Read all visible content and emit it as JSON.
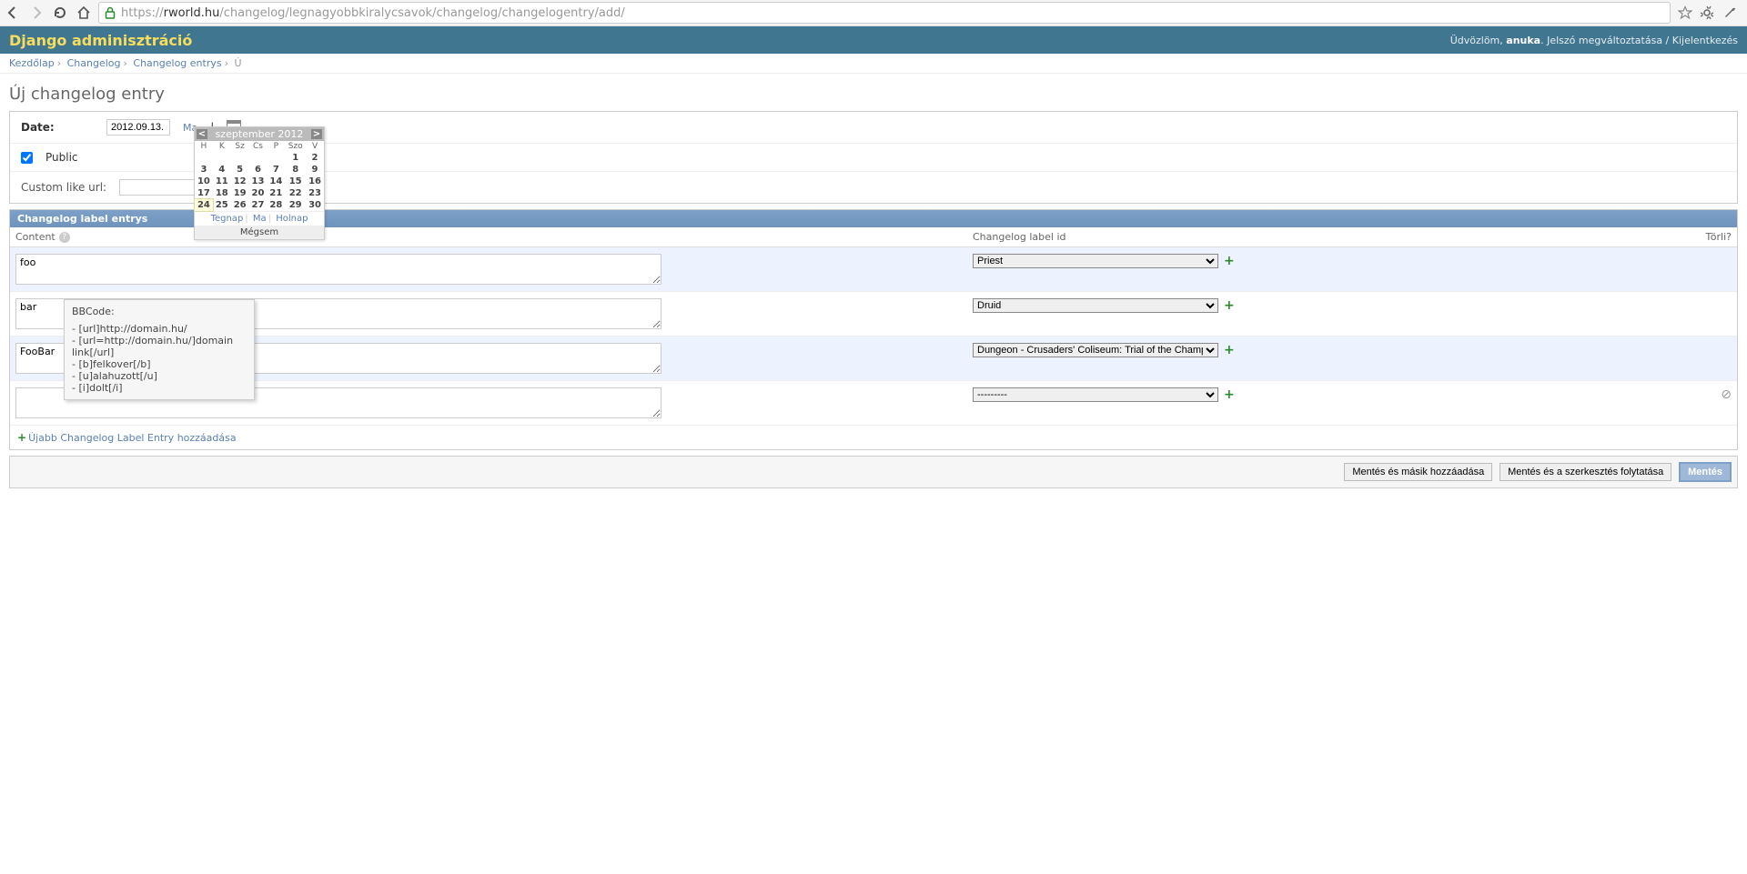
{
  "browser": {
    "url_prefix": "https://",
    "url_host": "rworld.hu",
    "url_path": "/changelog/legnagyobbkiralycsavok/changelog/changelogentry/add/"
  },
  "header": {
    "brand": "Django adminisztráció",
    "welcome_prefix": "Üdvözlöm, ",
    "user": "anuka",
    "pw_change": "Jelszó megváltoztatása",
    "logout": "Kijelentkezés"
  },
  "breadcrumbs": {
    "home": "Kezdőlap",
    "app": "Changelog",
    "model": "Changelog entrys",
    "current_abbrev": "Ú"
  },
  "page": {
    "title": "Új changelog entry"
  },
  "form": {
    "date_label": "Date:",
    "date_value": "2012.09.13.",
    "today_link": "Ma",
    "public_label": "Public",
    "public_checked": true,
    "custom_url_label": "Custom like url:",
    "custom_url_value": ""
  },
  "calendar": {
    "month_label": "szeptember 2012",
    "dow": [
      "H",
      "K",
      "Sz",
      "Cs",
      "P",
      "Szo",
      "V"
    ],
    "weeks": [
      [
        "",
        "",
        "",
        "",
        "",
        "1",
        "2"
      ],
      [
        "3",
        "4",
        "5",
        "6",
        "7",
        "8",
        "9"
      ],
      [
        "10",
        "11",
        "12",
        "13",
        "14",
        "15",
        "16"
      ],
      [
        "17",
        "18",
        "19",
        "20",
        "21",
        "22",
        "23"
      ],
      [
        "24",
        "25",
        "26",
        "27",
        "28",
        "29",
        "30"
      ]
    ],
    "today_cell": "24",
    "yesterday": "Tegnap",
    "today": "Ma",
    "tomorrow": "Holnap",
    "cancel": "Mégsem"
  },
  "tooltip": {
    "title": "BBCode:",
    "lines": [
      "- [url]http://domain.hu/",
      "- [url=http://domain.hu/]domain link[/url]",
      "- [b]felkover[/b]",
      "- [u]alahuzott[/u]",
      "- [i]dolt[/i]"
    ]
  },
  "inline": {
    "section_title": "Changelog label entrys",
    "col_content": "Content",
    "col_label": "Changelog label id",
    "col_delete": "Törli?",
    "add_text": "Újabb Changelog Label Entry hozzáadása",
    "rows": [
      {
        "content": "foo",
        "label": "Priest",
        "delete": false
      },
      {
        "content": "bar",
        "label": "Druid",
        "delete": false
      },
      {
        "content": "FooBar",
        "label": "Dungeon - Crusaders' Coliseum: Trial of the Champion",
        "delete": false
      },
      {
        "content": "",
        "label": "---------",
        "delete": true
      }
    ]
  },
  "submit": {
    "save_add": "Mentés és másik hozzáadása",
    "save_cont": "Mentés és a szerkesztés folytatása",
    "save": "Mentés"
  }
}
